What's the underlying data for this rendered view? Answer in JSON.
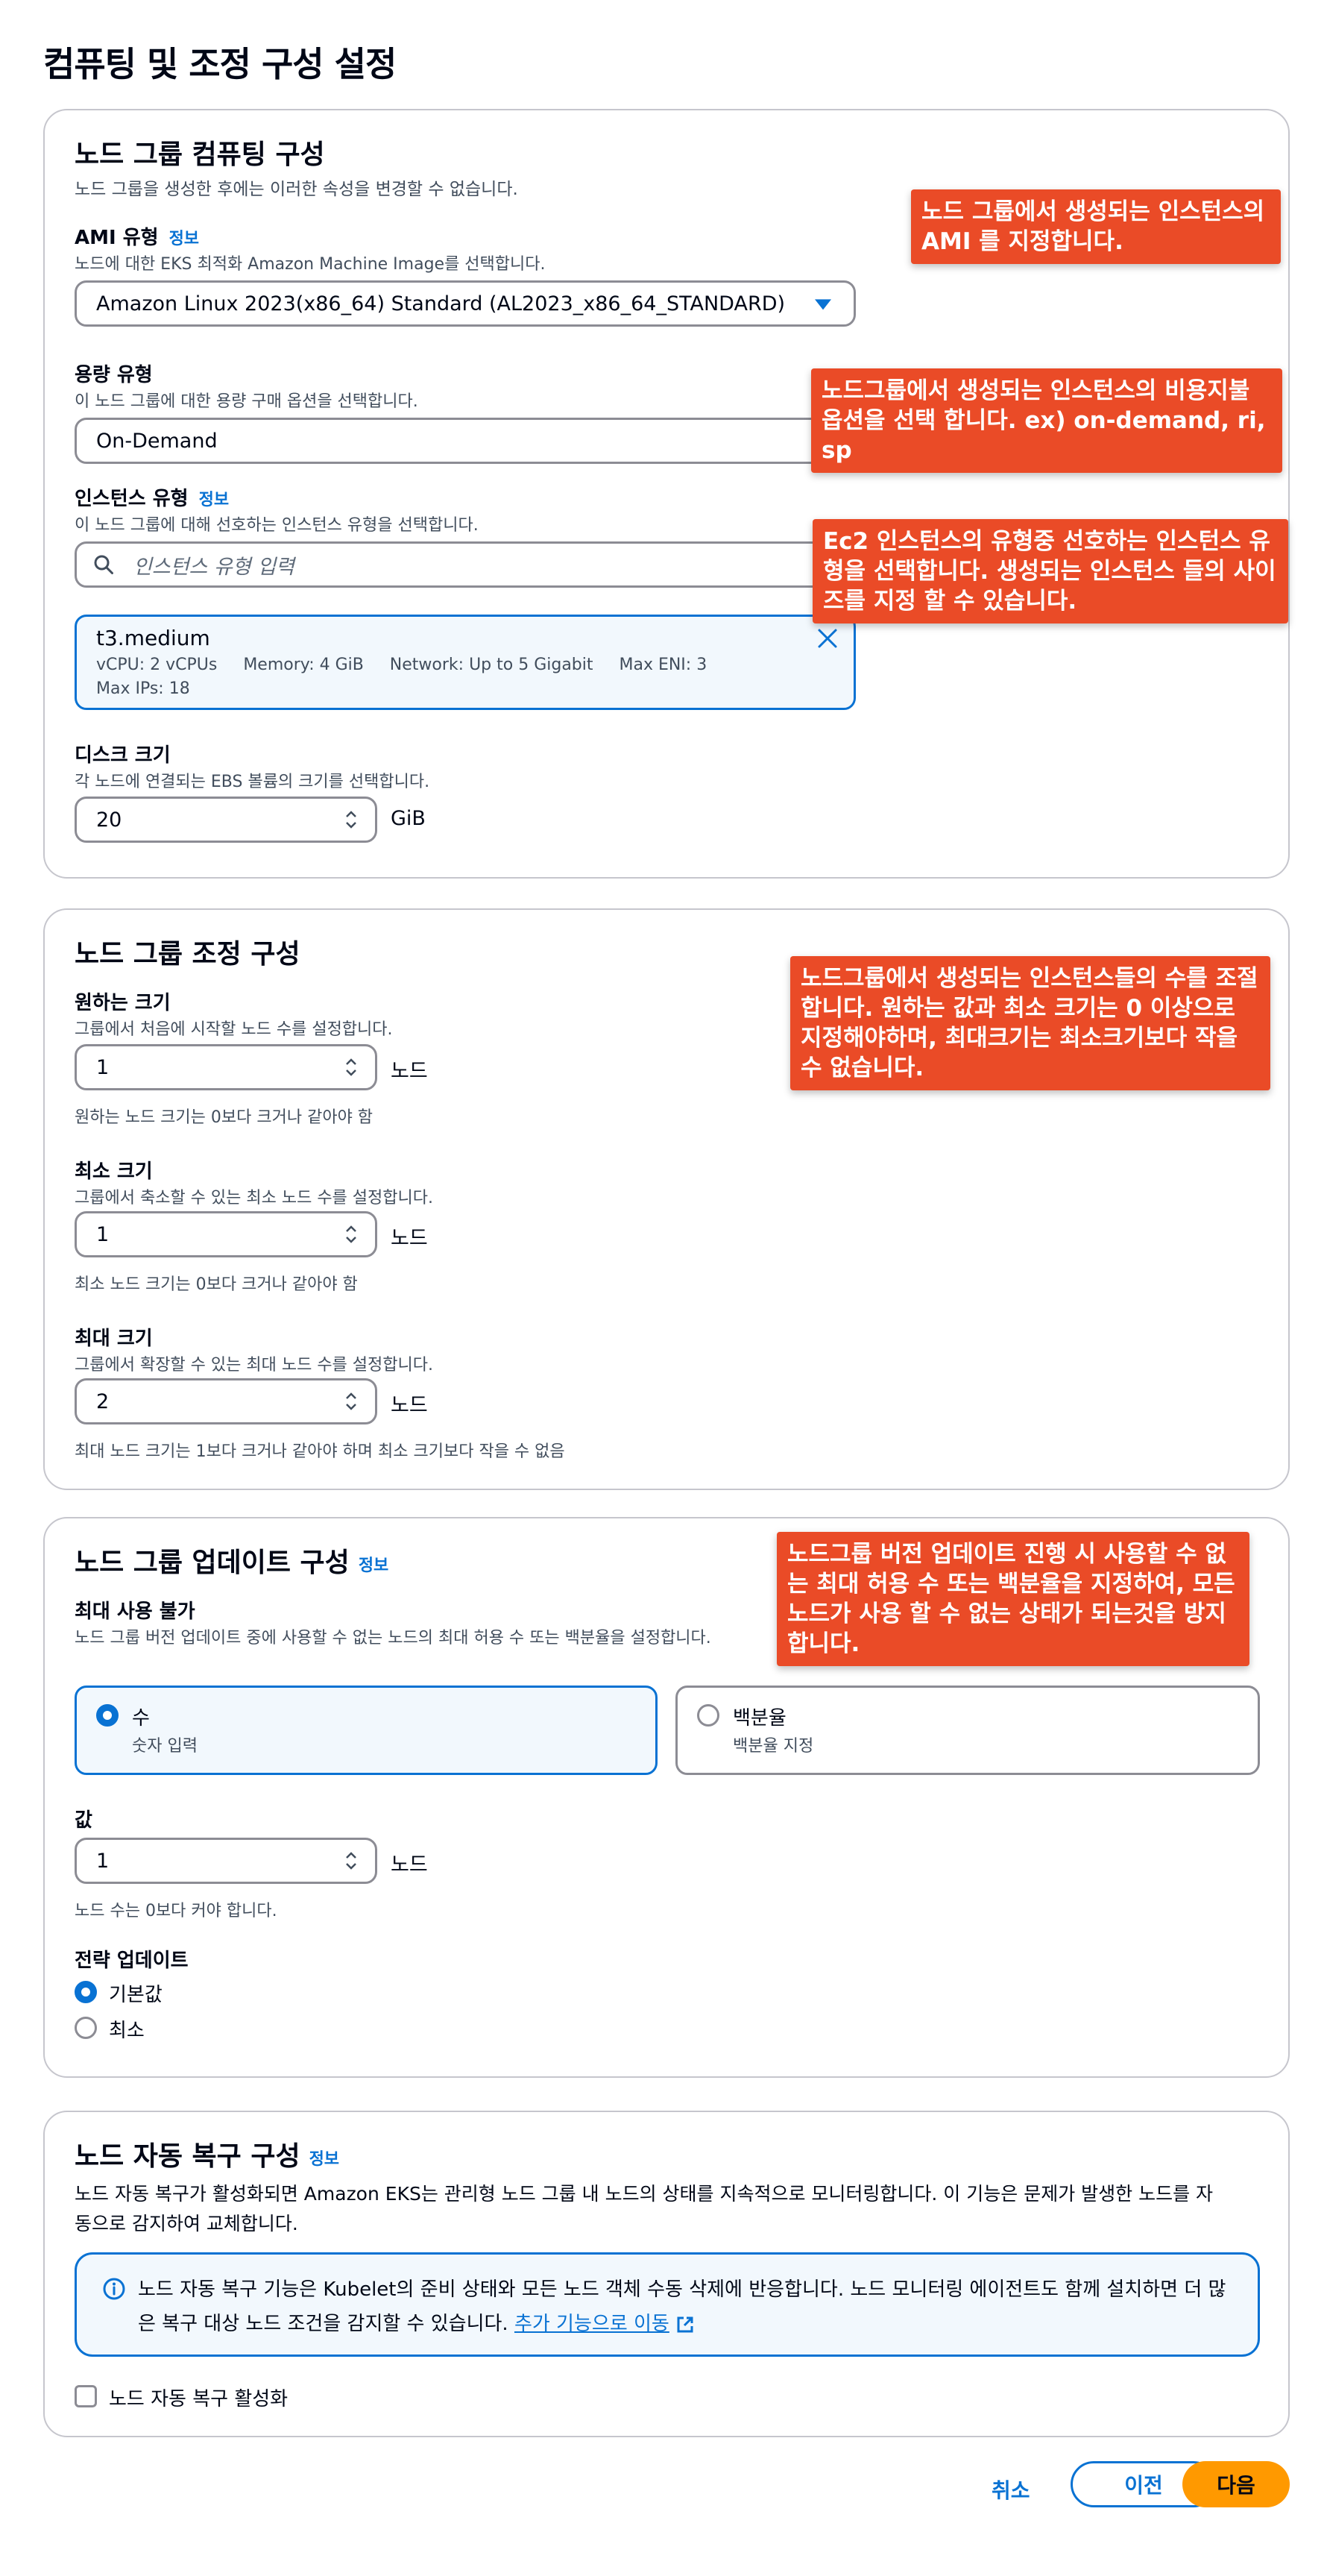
{
  "page_title": "컴퓨팅 및 조정 구성 설정",
  "compute": {
    "title": "노드 그룹 컴퓨팅 구성",
    "description": "노드 그룹을 생성한 후에는 이러한 속성을 변경할 수 없습니다.",
    "ami": {
      "label": "AMI 유형",
      "info": "정보",
      "description": "노드에 대한 EKS 최적화 Amazon Machine Image를 선택합니다.",
      "value": "Amazon Linux 2023(x86_64) Standard (AL2023_x86_64_STANDARD)"
    },
    "capacity": {
      "label": "용량 유형",
      "description": "이 노드 그룹에 대한 용량 구매 옵션을 선택합니다.",
      "value": "On-Demand"
    },
    "instance": {
      "label": "인스턴스 유형",
      "info": "정보",
      "description": "이 노드 그룹에 대해 선호하는 인스턴스 유형을 선택합니다.",
      "placeholder": "인스턴스 유형 입력",
      "selected": {
        "name": "t3.medium",
        "meta1": "vCPU: 2 vCPUs     Memory: 4 GiB     Network: Up to 5 Gigabit     Max ENI: 3",
        "meta2": "Max IPs: 18"
      }
    },
    "disk": {
      "label": "디스크 크기",
      "description": "각 노드에 연결되는 EBS 볼륨의 크기를 선택합니다.",
      "value": "20",
      "unit": "GiB"
    }
  },
  "scaling": {
    "title": "노드 그룹 조정 구성",
    "desired": {
      "label": "원하는 크기",
      "description": "그룹에서 처음에 시작할 노드 수를 설정합니다.",
      "value": "1",
      "unit": "노드",
      "hint": "원하는 노드 크기는 0보다 크거나 같아야 함"
    },
    "min": {
      "label": "최소 크기",
      "description": "그룹에서 축소할 수 있는 최소 노드 수를 설정합니다.",
      "value": "1",
      "unit": "노드",
      "hint": "최소 노드 크기는 0보다 크거나 같아야 함"
    },
    "max": {
      "label": "최대 크기",
      "description": "그룹에서 확장할 수 있는 최대 노드 수를 설정합니다.",
      "value": "2",
      "unit": "노드",
      "hint": "최대 노드 크기는 1보다 크거나 같아야 하며 최소 크기보다 작을 수 없음"
    }
  },
  "update": {
    "title": "노드 그룹 업데이트 구성",
    "info": "정보",
    "max_unavailable": {
      "label": "최대 사용 불가",
      "description": "노드 그룹 버전 업데이트 중에 사용할 수 없는 노드의 최대 허용 수 또는 백분율을 설정합니다."
    },
    "tiles": [
      {
        "title": "수",
        "desc": "숫자 입력",
        "selected": true
      },
      {
        "title": "백분율",
        "desc": "백분율 지정",
        "selected": false
      }
    ],
    "value": {
      "label": "값",
      "value": "1",
      "unit": "노드",
      "hint": "노드 수는 0보다 커야 합니다."
    },
    "strategy": {
      "label": "전략 업데이트",
      "options": [
        {
          "label": "기본값",
          "selected": true
        },
        {
          "label": "최소",
          "selected": false
        }
      ]
    }
  },
  "repair": {
    "title": "노드 자동 복구 구성",
    "info": "정보",
    "description_line1": "노드 자동 복구가 활성화되면 Amazon EKS는 관리형 노드 그룹 내 노드의 상태를 지속적으로 모니터링합니다. 이 기능은 문제가 발생한 노드를 자",
    "description_line2": "동으로 감지하여 교체합니다.",
    "alert_text": "노드 자동 복구 기능은 Kubelet의 준비 상태와 모든 노드 객체 수동 삭제에 반응합니다. 노드 모니터링 에이전트도 함께 설치하면 더 많은 복구 대상 노드 조건을 감지할 수 있습니다.",
    "alert_link": "추가 기능으로 이동",
    "checkbox_label": "노드 자동 복구 활성화"
  },
  "footer": {
    "cancel": "취소",
    "previous": "이전",
    "next": "다음"
  },
  "callouts": {
    "ami": "노드 그룹에서 생성되는 인스턴스의 AMI 를 지정합니다.",
    "capacity": "노드그룹에서 생성되는 인스턴스의 비용지불 옵션을 선택 합니다. ex) on-demand, ri, sp",
    "instance": "Ec2 인스턴스의 유형중 선호하는 인스턴스 유형을 선택합니다. 생성되는 인스턴스 들의 사이즈를 지정 할 수 있습니다.",
    "scaling": "노드그룹에서 생성되는 인스턴스들의 수를 조절합니다. 원하는 값과 최소 크기는 0 이상으로 지정해야하며, 최대크기는 최소크기보다 작을 수 없습니다.",
    "update": "노드그룹 버전 업데이트 진행 시 사용할 수 없는 최대 허용 수 또는 백분율을 지정하여, 모든 노드가 사용 할 수 없는 상태가 되는것을 방지 합니다."
  },
  "colors": {
    "accent": "#0972d3",
    "primary_button": "#ff9900",
    "callout": "#ea4b27",
    "border": "#c6c6cd"
  }
}
